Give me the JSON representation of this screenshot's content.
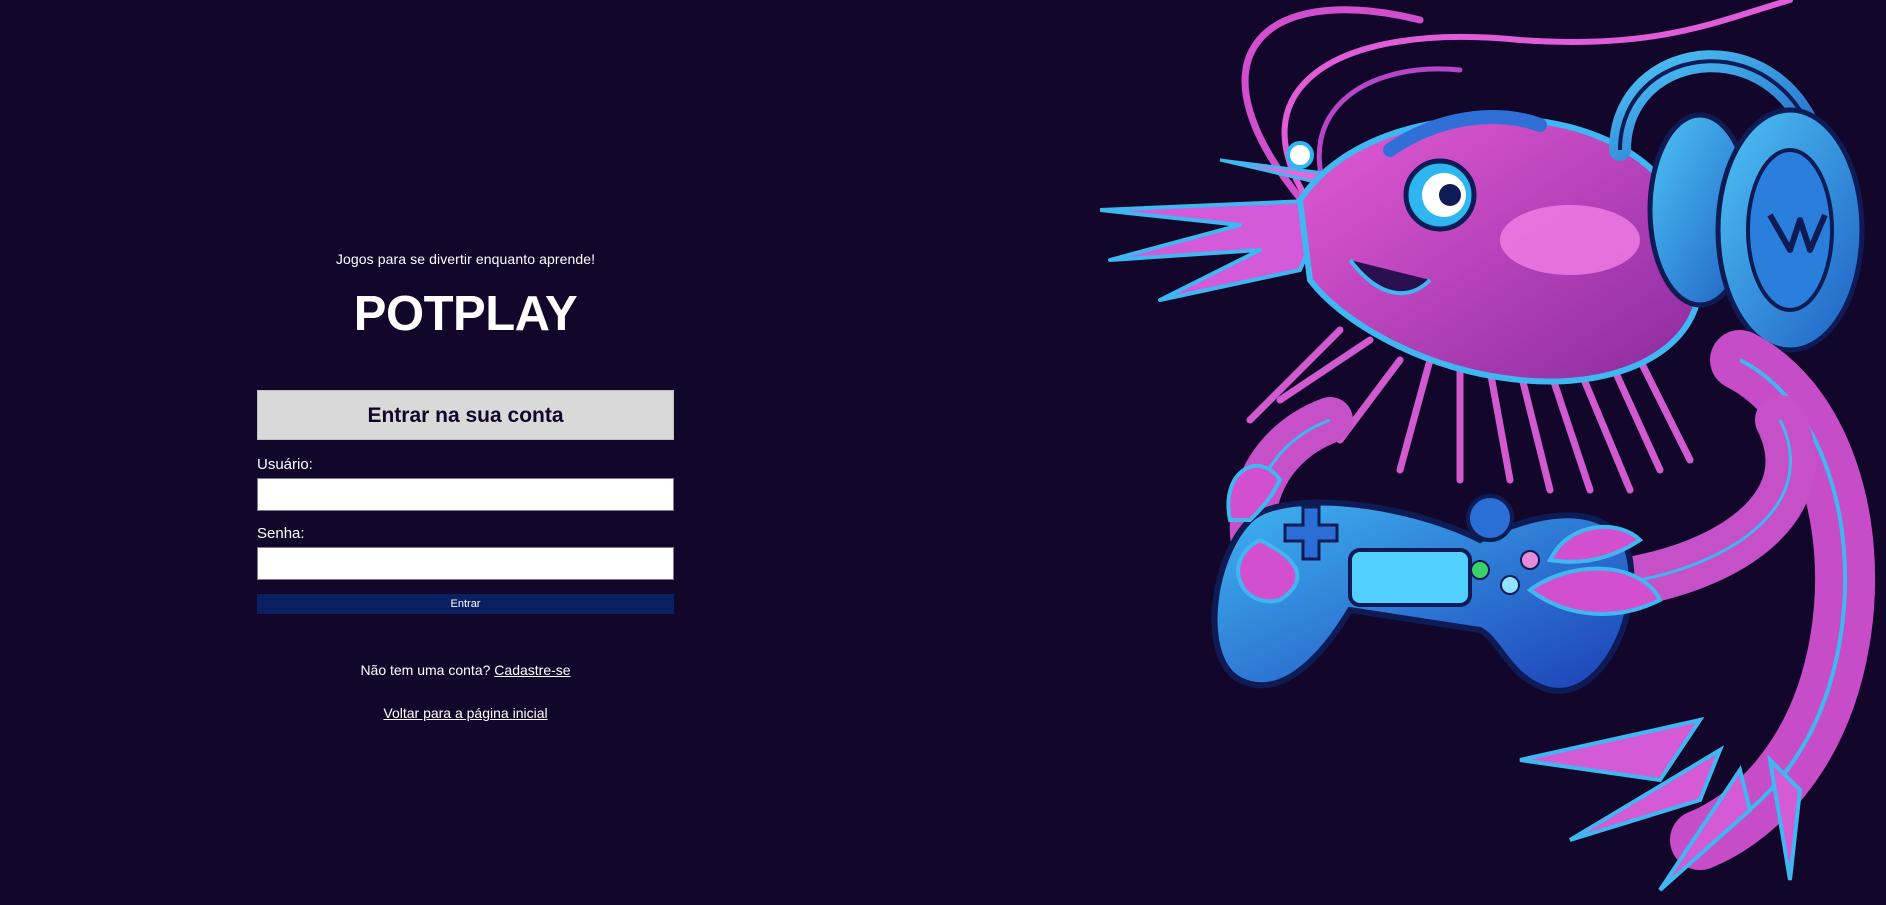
{
  "login": {
    "tagline": "Jogos para se divertir enquanto aprende!",
    "brand": "POTPLAY",
    "form_title": "Entrar na sua conta",
    "username_label": "Usuário:",
    "username_value": "",
    "password_label": "Senha:",
    "password_value": "",
    "submit_label": "Entrar",
    "signup_prompt": "Não tem uma conta?",
    "signup_link": "Cadastre-se",
    "back_link": "Voltar para a página inicial"
  },
  "colors": {
    "background": "#12072b",
    "form_header_bg": "#d9d9d9",
    "button_bg": "#0a2060",
    "mascot_pink": "#d94fc9",
    "mascot_blue": "#2fb6f0"
  },
  "icons": {
    "mascot": "shrimp-gamer-mascot-illustration"
  }
}
